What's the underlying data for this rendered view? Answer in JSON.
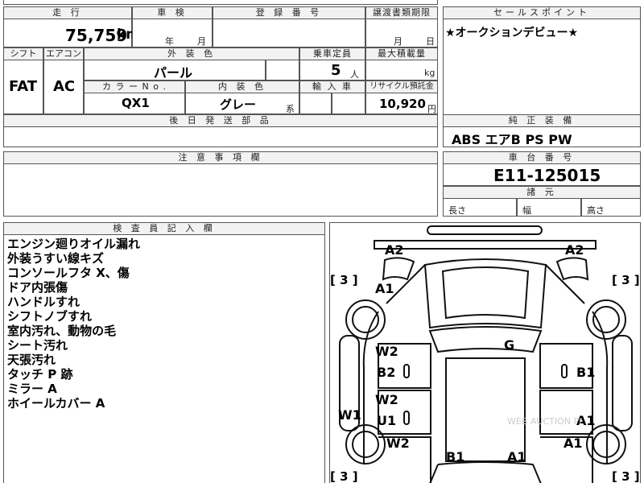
{
  "top_partial": "",
  "header": {
    "mileage_label": "走 行",
    "inspection_label": "車 検",
    "registration_label": "登 録 番 号",
    "transfer_label": "譲渡書類期限",
    "sale_point_label": "セールスポイント"
  },
  "mileage": {
    "value": "75,759",
    "unit": "km"
  },
  "inspection": {
    "year": "年",
    "month": "月"
  },
  "transfer": {
    "month": "月",
    "day": "日"
  },
  "sale_point": {
    "text": "★オークションデビュー★"
  },
  "row2": {
    "shift_label": "シフト",
    "ac_label": "エアコン",
    "exterior_label": "外 装 色",
    "capacity_label": "乗車定員",
    "max_load_label": "最大積載量",
    "shift": "FAT",
    "ac": "AC",
    "exterior_color": "パール",
    "capacity": "5",
    "capacity_unit": "人",
    "load_unit": "kg"
  },
  "row3": {
    "color_no_label": "カ ラ ー N o .",
    "interior_label": "内 装 色",
    "import_label": "輸 入 車",
    "recycle_label": "リサイクル預託金",
    "color_no": "QX1",
    "interior_color": "グレー",
    "interior_suffix": "系",
    "recycle": "10,920",
    "recycle_unit": "円"
  },
  "parts": {
    "label": "後 日 発 送 部 品"
  },
  "equipment": {
    "label": "純 正 装 備",
    "value": "ABS エアB PS PW"
  },
  "notes": {
    "label": "注 意 事 項 欄"
  },
  "chassis": {
    "label": "車 台 番 号",
    "value": "E11-125015"
  },
  "dimensions": {
    "label": "諸 元",
    "length": "長さ",
    "width": "幅",
    "height": "高さ"
  },
  "inspector": {
    "label": "検 査 員 記 入 欄",
    "remarks": [
      "エンジン廻りオイル漏れ",
      "外装うすい線キズ",
      "コンソールフタ X、傷",
      "ドア内張傷",
      "ハンドルすれ",
      "シフトノブすれ",
      "室内汚れ、動物の毛",
      "シート汚れ",
      "天張汚れ",
      "タッチ P 跡",
      "ミラー A",
      "ホイールカバー A"
    ]
  },
  "diagram": {
    "marks": {
      "a2_left": "A2",
      "a2_right": "A2",
      "a1_hood": "A1",
      "g_windshield": "G",
      "w2_front_left": "W2",
      "b2_left": "B2",
      "b1_right": "B1",
      "w2_rear_left": "W2",
      "u1_left": "U1",
      "a1_right_door": "A1",
      "w1_left": "W1",
      "w2_lower_left": "W2",
      "a1_lower_right": "A1",
      "b1_rear": "B1",
      "a1_rear": "A1"
    },
    "tires": {
      "front_left": "[ 3 ]",
      "front_right": "[ 3 ]",
      "rear_left": "[ 3 ]",
      "rear_right": "[ 3 ]"
    },
    "watermark": "WEB AUCTION PI"
  }
}
